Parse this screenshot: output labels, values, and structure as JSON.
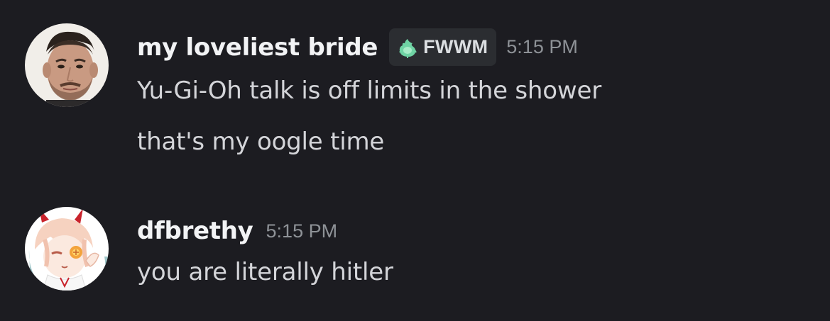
{
  "messages": [
    {
      "username": "my loveliest bride",
      "tag": {
        "label": "FWWM",
        "icon": "green-flame-icon",
        "color": "#6fd3a4"
      },
      "timestamp": "5:15 PM",
      "lines": [
        "Yu-Gi-Oh talk is off limits in the shower",
        "that's my oogle time"
      ]
    },
    {
      "username": "dfbrethy",
      "timestamp": "5:15 PM",
      "lines": [
        "you are literally hitler"
      ]
    }
  ],
  "colors": {
    "background": "#1c1c21",
    "username": "#f2f3f5",
    "message_text": "#d4d5d9",
    "timestamp": "#8e9297",
    "tag_background": "#2b2d31"
  }
}
